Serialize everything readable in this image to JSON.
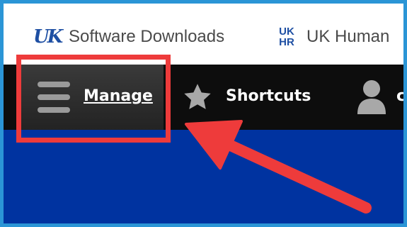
{
  "bookmarks": [
    {
      "label": "Software Downloads",
      "icon": "uk-logo-icon"
    },
    {
      "label": "UK Human",
      "icon": "ukhr-logo-icon",
      "logo_text_top": "UK",
      "logo_text_bottom": "HR"
    }
  ],
  "toolbar": {
    "manage_label": "Manage",
    "shortcuts_label": "Shortcuts",
    "user_initial": "c"
  },
  "colors": {
    "frame_border": "#2b95d6",
    "toolbar_bg": "#0d0d0d",
    "banner_bg": "#0033a0",
    "highlight_red": "#ee3b3b",
    "uk_blue": "#1e4fa3"
  }
}
